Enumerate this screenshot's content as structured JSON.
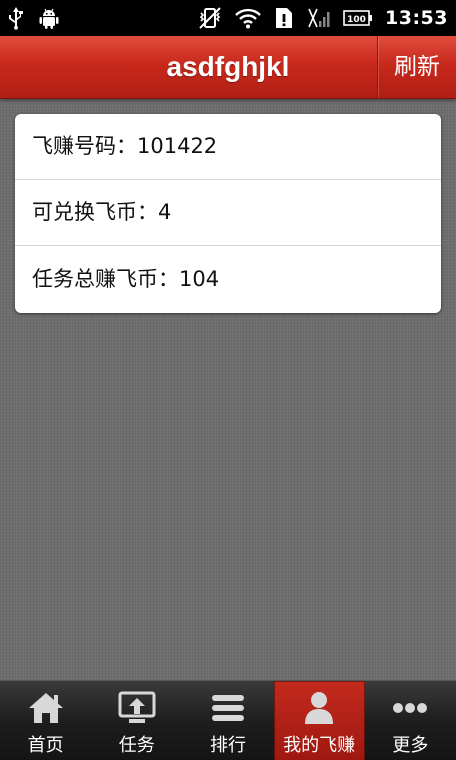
{
  "status_bar": {
    "time": "13:53",
    "battery": "100",
    "icons": [
      "usb-icon",
      "android-debug-icon",
      "vibrate-off-icon",
      "wifi-icon",
      "sim-alert-icon",
      "signal-icon",
      "battery-icon"
    ]
  },
  "header": {
    "title": "asdfghjkl",
    "refresh_label": "刷新"
  },
  "info": {
    "rows": [
      "飞赚号码：101422",
      "可兑换飞币：4",
      "任务总赚飞币：104"
    ]
  },
  "tabs": [
    {
      "label": "首页",
      "icon": "home-icon",
      "active": false
    },
    {
      "label": "任务",
      "icon": "task-upload-icon",
      "active": false
    },
    {
      "label": "排行",
      "icon": "ranking-list-icon",
      "active": false
    },
    {
      "label": "我的飞赚",
      "icon": "user-icon",
      "active": true
    },
    {
      "label": "更多",
      "icon": "more-dots-icon",
      "active": false
    }
  ],
  "colors": {
    "header_red": "#c8291c",
    "active_tab_red": "#b01f15",
    "background_gray": "#6e6e6e",
    "tab_bar_dark": "#1e1e1e"
  }
}
